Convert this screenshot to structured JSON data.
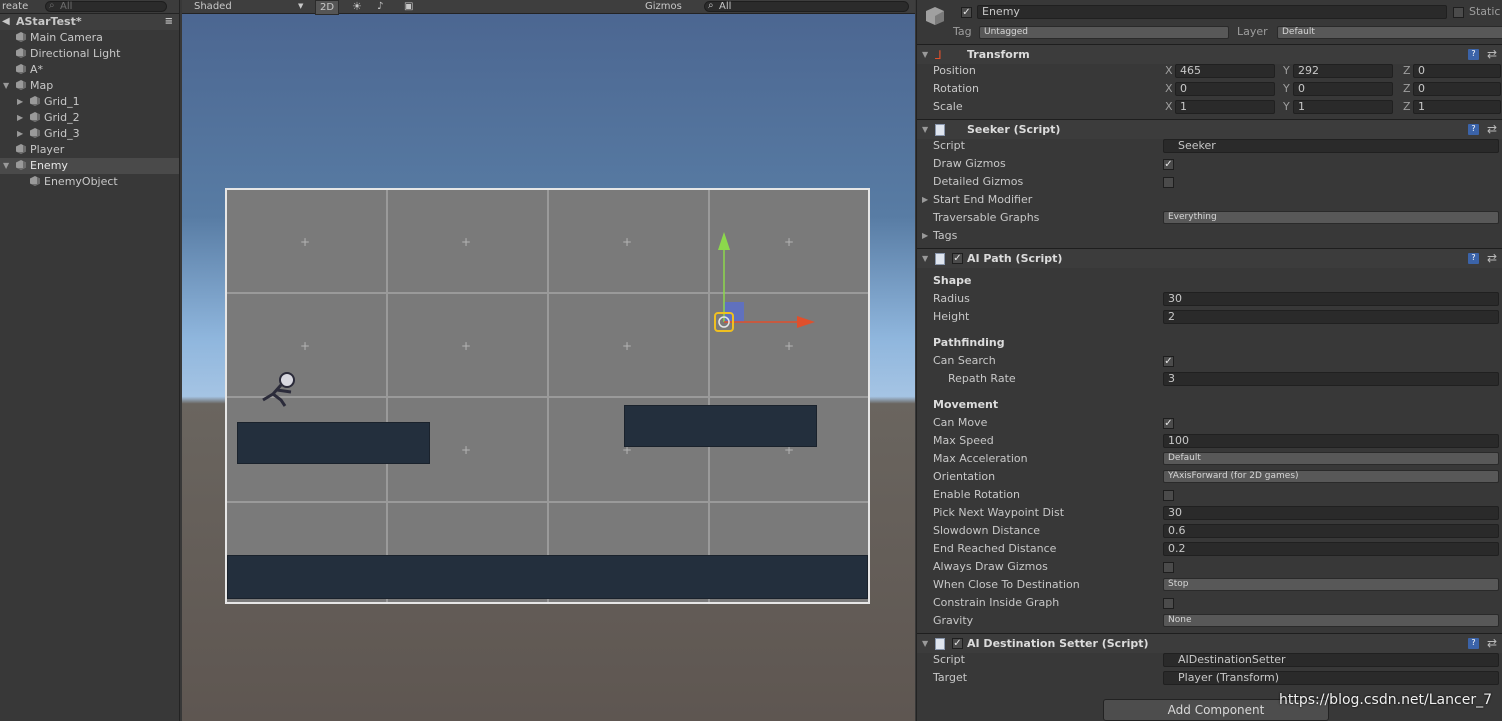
{
  "hierarchy": {
    "create_label": "reate",
    "search_placeholder": "All",
    "scene_name": "AStarTest*",
    "items": [
      {
        "label": "Main Camera"
      },
      {
        "label": "Directional Light"
      },
      {
        "label": "A*"
      },
      {
        "label": "Map"
      },
      {
        "label": "Grid_1"
      },
      {
        "label": "Grid_2"
      },
      {
        "label": "Grid_3"
      },
      {
        "label": "Player"
      },
      {
        "label": "Enemy"
      },
      {
        "label": "EnemyObject"
      }
    ]
  },
  "scene": {
    "shading": "Shaded",
    "btn_2d": "2D",
    "gizmos": "Gizmos",
    "search_placeholder": "All"
  },
  "inspector": {
    "object_name": "Enemy",
    "static_label": "Static",
    "tag_label": "Tag",
    "tag_value": "Untagged",
    "layer_label": "Layer",
    "layer_value": "Default",
    "transform": {
      "title": "Transform",
      "position_label": "Position",
      "rotation_label": "Rotation",
      "scale_label": "Scale",
      "x": "X",
      "y": "Y",
      "z": "Z",
      "position": [
        "465",
        "292",
        "0"
      ],
      "rotation": [
        "0",
        "0",
        "0"
      ],
      "scale": [
        "1",
        "1",
        "1"
      ]
    },
    "seeker": {
      "title": "Seeker (Script)",
      "script_label": "Script",
      "script_value": "Seeker",
      "draw_gizmos": "Draw Gizmos",
      "detailed_gizmos": "Detailed Gizmos",
      "start_end": "Start End Modifier",
      "traversable": "Traversable Graphs",
      "traversable_value": "Everything",
      "tags": "Tags"
    },
    "aipath": {
      "title": "AI Path (Script)",
      "shape": "Shape",
      "radius": "Radius",
      "radius_value": "30",
      "height": "Height",
      "height_value": "2",
      "pathfinding": "Pathfinding",
      "can_search": "Can Search",
      "repath": "Repath Rate",
      "repath_value": "3",
      "movement": "Movement",
      "can_move": "Can Move",
      "max_speed": "Max Speed",
      "max_speed_value": "100",
      "max_accel": "Max Acceleration",
      "max_accel_value": "Default",
      "orientation": "Orientation",
      "orientation_value": "YAxisForward (for 2D games)",
      "enable_rotation": "Enable Rotation",
      "pick_next": "Pick Next Waypoint Dist",
      "pick_next_value": "30",
      "slowdown": "Slowdown Distance",
      "slowdown_value": "0.6",
      "end_reached": "End Reached Distance",
      "end_reached_value": "0.2",
      "always_draw": "Always Draw Gizmos",
      "when_close": "When Close To Destination",
      "when_close_value": "Stop",
      "constrain": "Constrain Inside Graph",
      "gravity": "Gravity",
      "gravity_value": "None"
    },
    "dest": {
      "title": "AI Destination Setter (Script)",
      "script_label": "Script",
      "script_value": "AIDestinationSetter",
      "target_label": "Target",
      "target_value": "Player (Transform)"
    },
    "add_component": "Add Component",
    "watermark": "https://blog.csdn.net/Lancer_7"
  }
}
